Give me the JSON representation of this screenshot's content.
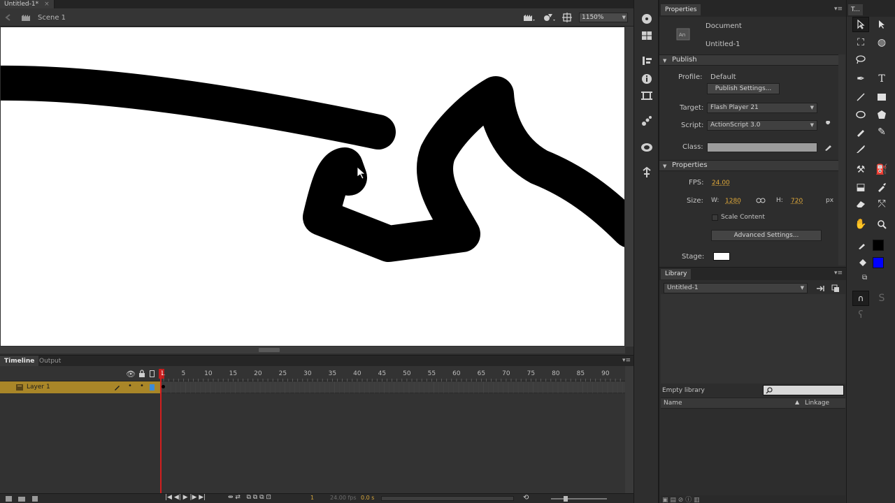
{
  "document": {
    "tab_title": "Untitled-1*",
    "scene": "Scene 1",
    "zoom": "1150%"
  },
  "timeline": {
    "tabs": [
      "Timeline",
      "Output"
    ],
    "frame_numbers": [
      "1",
      "5",
      "10",
      "15",
      "20",
      "25",
      "30",
      "35",
      "40",
      "45",
      "50",
      "55",
      "60",
      "65",
      "70",
      "75",
      "80",
      "85",
      "90"
    ],
    "layer_name": "Layer 1",
    "current_frame": "1",
    "fps_display": "24.00 fps",
    "time_display": "0.0 s"
  },
  "properties": {
    "tab": "Properties",
    "doc_type": "Document",
    "doc_name": "Untitled-1",
    "publish": {
      "heading": "Publish",
      "profile_label": "Profile:",
      "profile_value": "Default",
      "settings_button": "Publish Settings...",
      "target_label": "Target:",
      "target_value": "Flash Player 21",
      "script_label": "Script:",
      "script_value": "ActionScript 3.0",
      "class_label": "Class:"
    },
    "props": {
      "heading": "Properties",
      "fps_label": "FPS:",
      "fps_value": "24.00",
      "size_label": "Size:",
      "w_label": "W:",
      "w_value": "1280",
      "h_label": "H:",
      "h_value": "720",
      "unit": "px",
      "scale_label": "Scale Content",
      "advanced_button": "Advanced Settings...",
      "stage_label": "Stage:",
      "stage_color": "#ffffff"
    }
  },
  "library": {
    "tab": "Library",
    "selected_doc": "Untitled-1",
    "empty_text": "Empty library",
    "col_name": "Name",
    "col_linkage": "Linkage"
  },
  "tools_panel": {
    "tab": "T...",
    "stroke_color": "#000000",
    "fill_color": "#0000ff"
  },
  "colors": {
    "accent": "#d8a73a",
    "layer_highlight": "#a98628",
    "playhead": "#d21f1f"
  }
}
